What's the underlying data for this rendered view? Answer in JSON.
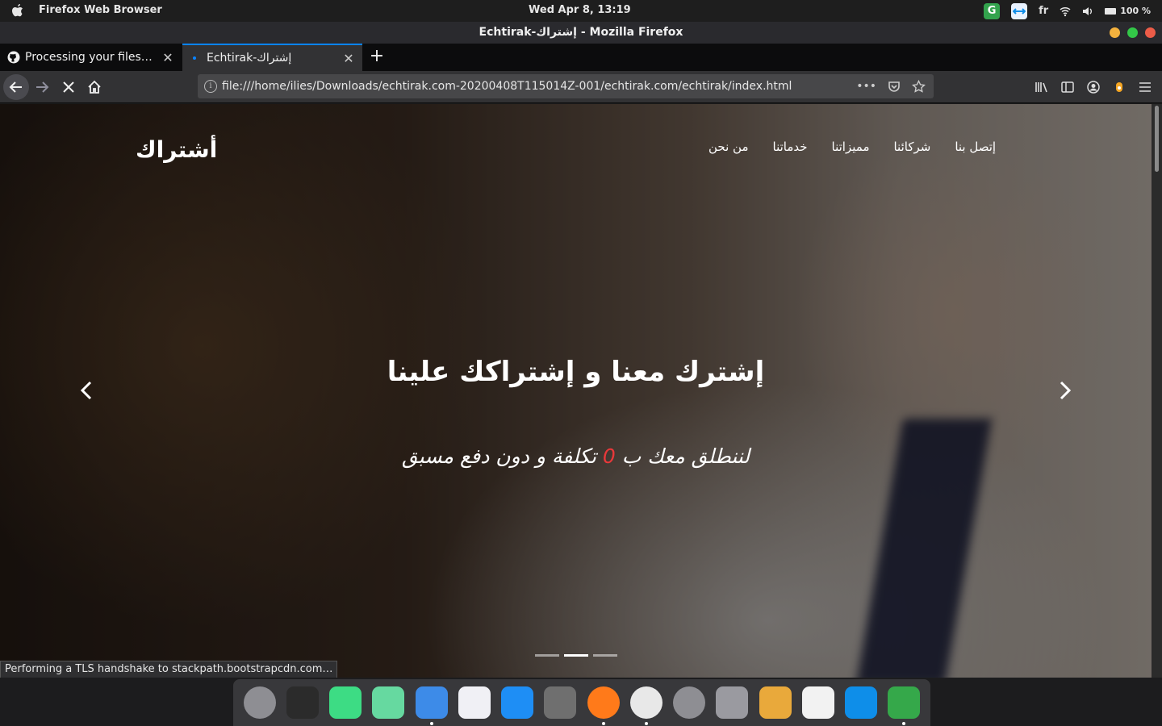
{
  "topbar": {
    "app_name": "Firefox Web Browser",
    "clock": "Wed Apr  8, 13:19",
    "lang": "fr",
    "battery": "100 %"
  },
  "window": {
    "title": "Echtirak-إشتراك - Mozilla Firefox"
  },
  "tabs": [
    {
      "label": "Processing your files…",
      "favicon": "github-icon"
    },
    {
      "label": "Echtirak-إشتراك",
      "favicon": "loading-dot"
    }
  ],
  "navbar": {
    "url": "file:///home/ilies/Downloads/echtirak.com-20200408T115014Z-001/echtirak.com/echtirak/index.html",
    "page_actions_label": "•••"
  },
  "page": {
    "logo": "أشتراك",
    "menu": [
      "إتصل بنا",
      "شركائنا",
      "مميزاتنا",
      "خدماتنا",
      "من نحن"
    ],
    "headline": "إشترك معنا و إشتراكك علينا",
    "subline_start": "لننطلق معك ب ",
    "subline_zero": "0",
    "subline_end": " تكلفة و دون دفع مسبق",
    "zero_color": "#e8383a",
    "carousel_active_index": 1,
    "carousel_count": 3
  },
  "status": "Performing a TLS handshake to stackpath.bootstrapcdn.com…",
  "dock": [
    {
      "name": "launchpad-icon",
      "color": "#8e8e93"
    },
    {
      "name": "terminal-icon",
      "color": "#2b2b2b"
    },
    {
      "name": "android-studio-icon",
      "color": "#3ddc84"
    },
    {
      "name": "atom-icon",
      "color": "#66d9a0"
    },
    {
      "name": "finder-icon",
      "color": "#3d8be8"
    },
    {
      "name": "itunes-icon",
      "color": "#f0f0f5"
    },
    {
      "name": "app-store-icon",
      "color": "#1e8ef5"
    },
    {
      "name": "gimp-icon",
      "color": "#6f6f6f"
    },
    {
      "name": "firefox-icon",
      "color": "#ff7a1a"
    },
    {
      "name": "chrome-icon",
      "color": "#e8e8e8"
    },
    {
      "name": "settings-icon",
      "color": "#8e8e93"
    },
    {
      "name": "system-preferences-icon",
      "color": "#9a9aa0"
    },
    {
      "name": "xcode-tools-icon",
      "color": "#e9a93b"
    },
    {
      "name": "activity-monitor-icon",
      "color": "#f2f2f2"
    },
    {
      "name": "teamviewer-icon",
      "color": "#0e8ee9"
    },
    {
      "name": "downloader-icon",
      "color": "#35a84a"
    }
  ]
}
